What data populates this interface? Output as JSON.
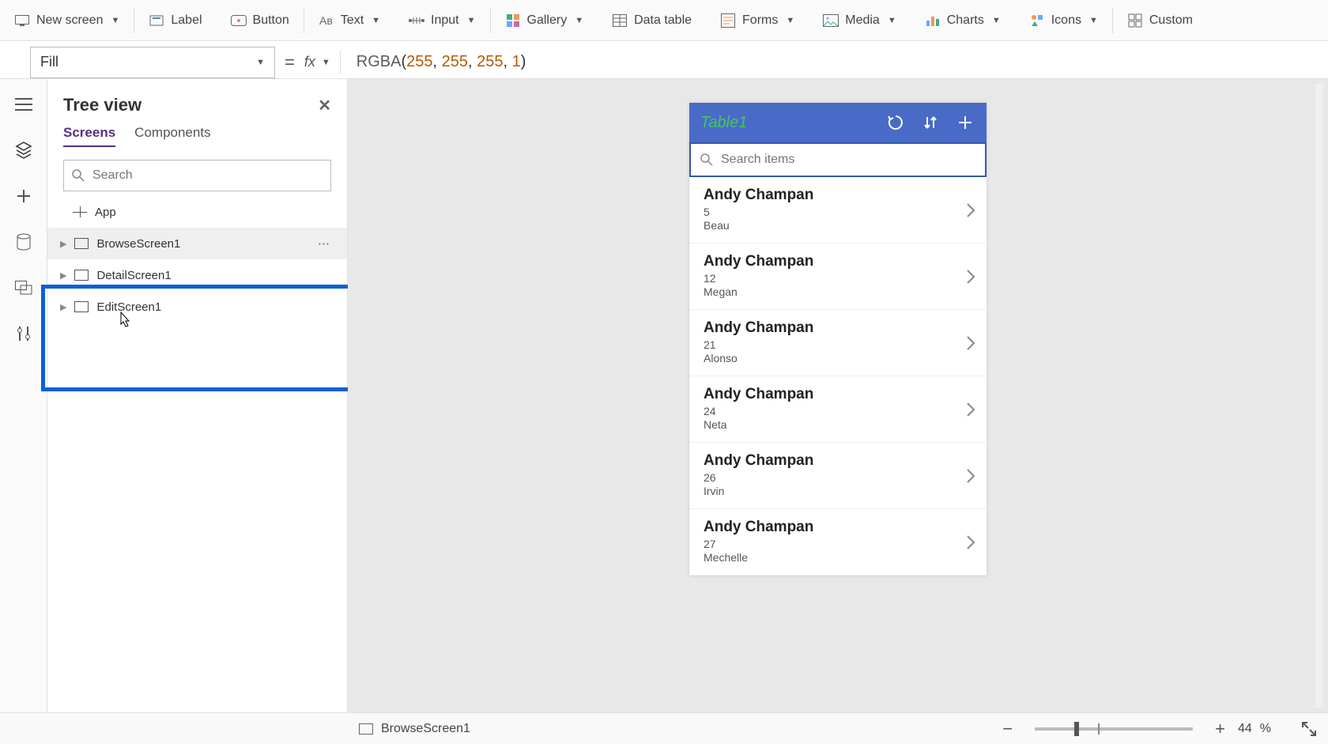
{
  "ribbon": {
    "new_screen": "New screen",
    "label": "Label",
    "button": "Button",
    "text": "Text",
    "input": "Input",
    "gallery": "Gallery",
    "data_table": "Data table",
    "forms": "Forms",
    "media": "Media",
    "charts": "Charts",
    "icons": "Icons",
    "custom": "Custom"
  },
  "formula": {
    "property": "Fill",
    "fn": "RGBA",
    "args": [
      "255",
      "255",
      "255",
      "1"
    ]
  },
  "tree": {
    "title": "Tree view",
    "tabs": {
      "screens": "Screens",
      "components": "Components"
    },
    "search_placeholder": "Search",
    "app_label": "App",
    "items": [
      {
        "label": "BrowseScreen1",
        "selected": true
      },
      {
        "label": "DetailScreen1",
        "selected": false
      },
      {
        "label": "EditScreen1",
        "selected": false
      }
    ]
  },
  "preview": {
    "title": "Table1",
    "search_placeholder": "Search items",
    "gallery": [
      {
        "title": "Andy Champan",
        "num": "5",
        "sub": "Beau"
      },
      {
        "title": "Andy Champan",
        "num": "12",
        "sub": "Megan"
      },
      {
        "title": "Andy Champan",
        "num": "21",
        "sub": "Alonso"
      },
      {
        "title": "Andy Champan",
        "num": "24",
        "sub": "Neta"
      },
      {
        "title": "Andy Champan",
        "num": "26",
        "sub": "Irvin"
      },
      {
        "title": "Andy Champan",
        "num": "27",
        "sub": "Mechelle"
      }
    ]
  },
  "status": {
    "screen_label": "BrowseScreen1",
    "zoom_pct": "44",
    "zoom_pct_suffix": "%"
  }
}
